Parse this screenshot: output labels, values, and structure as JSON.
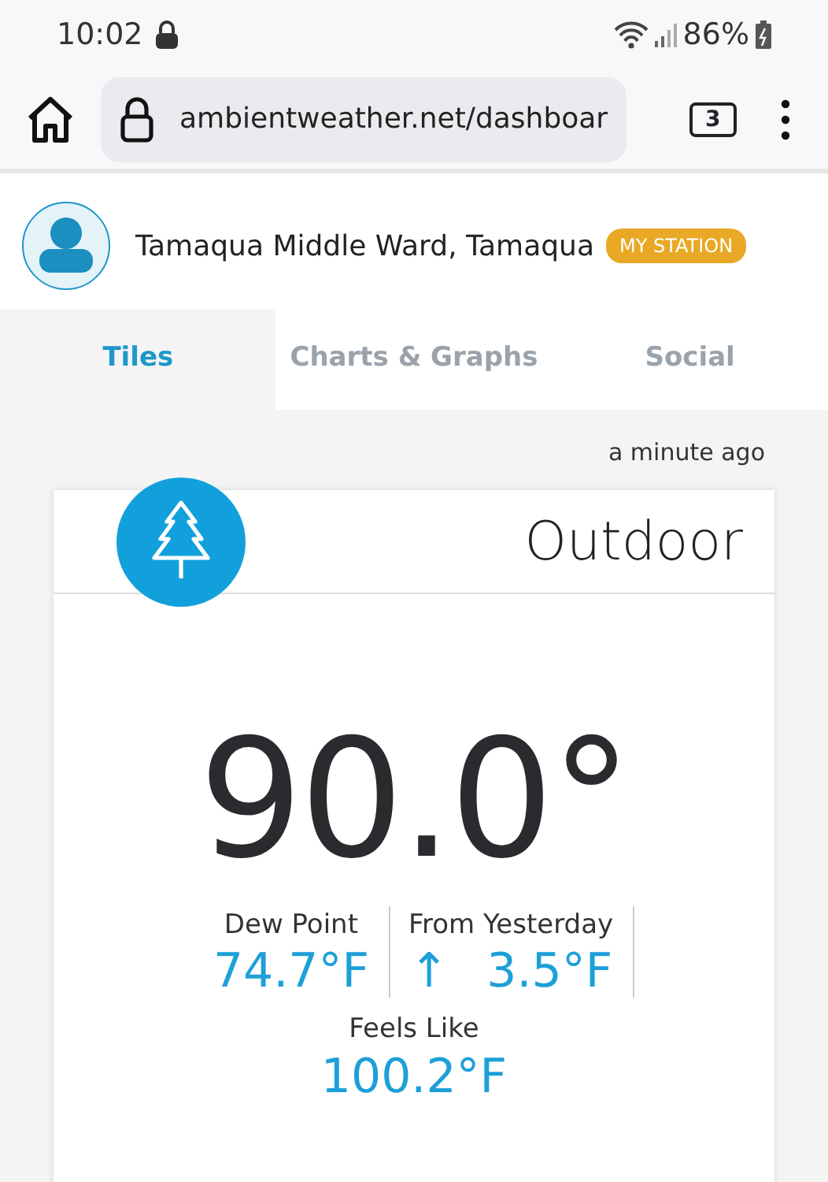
{
  "status_bar": {
    "time": "10:02",
    "battery": "86%"
  },
  "browser": {
    "url": "ambientweather.net/dashboar",
    "tab_count": "3"
  },
  "station": {
    "name": "Tamaqua Middle Ward, Tamaqua",
    "badge": "MY STATION"
  },
  "tabs": [
    {
      "label": "Tiles",
      "selected": true
    },
    {
      "label": "Charts & Graphs",
      "selected": false
    },
    {
      "label": "Social",
      "selected": false
    }
  ],
  "updated": "a minute ago",
  "tile": {
    "title": "Outdoor",
    "temperature": "90.0°",
    "stats": [
      {
        "label": "Dew Point",
        "value": "74.7°F"
      },
      {
        "label": "From Yesterday",
        "trend": "↑",
        "value": "3.5°F"
      }
    ],
    "feels_like": {
      "label": "Feels Like",
      "value": "100.2°F"
    }
  }
}
